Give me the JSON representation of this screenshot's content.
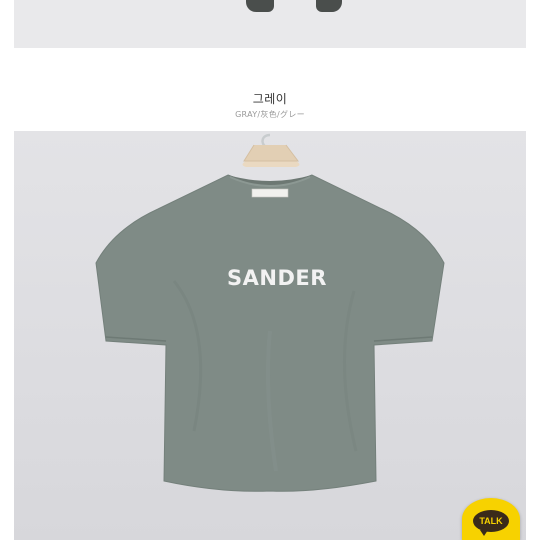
{
  "product_detail": {
    "color_title": "그레이",
    "color_subtitle": "GRAY/灰色/グレー",
    "shirt_print_text": "SANDER",
    "shirt_color": "#7f8b86",
    "background_color": "#dedee1"
  },
  "chat_button": {
    "label": "TALK",
    "color": "#f7d200"
  }
}
